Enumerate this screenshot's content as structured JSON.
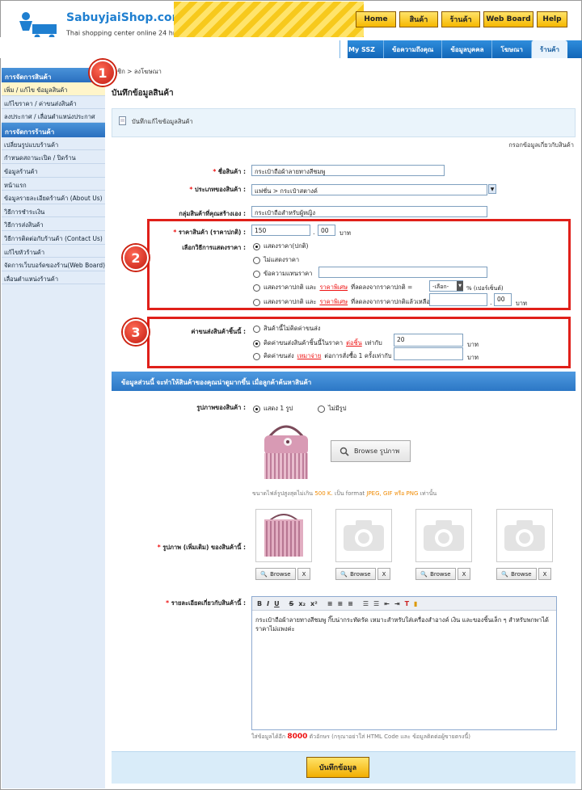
{
  "brand": {
    "name_a": "Sabuyjai",
    "name_b": "Shop.com",
    "reg": "®",
    "tagline": "Thai shopping center online 24 hr.",
    "tm": "TM"
  },
  "topnav": [
    "Home",
    "สินค้า",
    "ร้านค้า",
    "Web Board",
    "Help"
  ],
  "subnav": [
    {
      "label": "My SSZ",
      "active": false
    },
    {
      "label": "ข้อความถึงคุณ",
      "active": false
    },
    {
      "label": "ข้อมูลบุคคล",
      "active": false
    },
    {
      "label": "โฆษณา",
      "active": false
    },
    {
      "label": "ร้านค้า",
      "active": true
    }
  ],
  "sidebar": {
    "group1": "การจัดการสินค้า",
    "items1": [
      "เพิ่ม / แก้ไข ข้อมูลสินค้า",
      "แก้ไขราคา / ค่าขนส่งสินค้า",
      "ลงประกาศ / เลื่อนตำแหน่งประกาศ"
    ],
    "group2": "การจัดการร้านค้า",
    "items2": [
      "เปลี่ยนรูปแบบร้านค้า",
      "กำหนดสถานะเปิด / ปิดร้าน",
      "ข้อมูลร้านค้า",
      "หน้าแรก",
      "ข้อมูลรายละเอียดร้านค้า (About Us)",
      "วิธีการชำระเงิน",
      "วิธีการส่งสินค้า",
      "วิธีการติดต่อกับร้านค้า (Contact Us)",
      "แก้ไขหัวร้านค้า",
      "จัดการเว็บบอร์ดของร้าน(Web Board)",
      "เลื่อนตำแหน่งร้านค้า"
    ]
  },
  "breadcrumb": "...ชิก > ลงโฆษณา",
  "page_title": "บันทึกข้อมูลสินค้า",
  "panel_title": "บันทึกแก้ไขข้อมูลสินค้า",
  "fill_note": "กรอกข้อมูลเกี่ยวกับสินค้า",
  "form": {
    "name_label": "ชื่อสินค้า :",
    "name_value": "กระเป๋าถือผ้าลายทางสีชมพู",
    "type_label": "ประเภทของสินค้า :",
    "type_value": "แฟชั่น > กระเป๋าสตางค์",
    "group_label": "กลุ่มสินค้าที่คุณสร้างเอง :",
    "group_value": "กระเป๋าถือสำหรับผู้หญิง",
    "price_label": "ราคาสินค้า (ราคาปกติ) :",
    "price_int": "150",
    "price_dec": "00",
    "baht": "บาท",
    "display_label": "เลือกวิธีการแสดงราคา :",
    "display_opts": [
      "แสดงราคา(ปกติ)",
      "ไม่แสดงราคา",
      "ข้อความแทนราคา"
    ],
    "disc1_a": "แสดงราคาปกติ และ",
    "disc1_link": "ราคาพิเศษ",
    "disc1_b": "ที่ลดลงจากราคาปกติ =",
    "disc1_select": "-เลือก-",
    "disc1_c": "% (เปอร์เซ็นต์)",
    "disc2_a": "แสดงราคาปกติ และ",
    "disc2_link": "ราคาพิเศษ",
    "disc2_b": "ที่ลดลงจากราคาปกติแล้วเหลือ",
    "disc2_dec": "00",
    "ship_label": "ค่าขนส่งสินค้าชิ้นนี้ :",
    "ship_opt1": "สินค้านี้ไม่คิดค่าขนส่ง",
    "ship_opt2_a": "คิดค่าขนส่งสินค้าชิ้นนี้ในราคา",
    "ship_opt2_link": "ต่อชิ้น",
    "ship_opt2_b": "เท่ากับ",
    "ship_value": "20",
    "ship_opt3_a": "คิดค่าขนส่ง",
    "ship_opt3_link": "เหมาจ่าย",
    "ship_opt3_b": "ต่อการสั่งซื้อ 1 ครั้งเท่ากับ"
  },
  "section_banner": "ข้อมูลส่วนนี้ จะทำให้สินค้าของคุณน่าดูมากขึ้น เมื่อลูกค้าค้นหาสินค้า",
  "image": {
    "label": "รูปภาพของสินค้า :",
    "opt_show": "แสดง 1 รูป",
    "opt_none": "ไม่มีรูป",
    "browse": "Browse รูปภาพ",
    "note_a": "ขนาดไฟล์รูปสูงสุดไม่เกิน",
    "note_size": "500 K.",
    "note_b": "เป็น format",
    "note_formats": "JPEG, GIF หรือ PNG",
    "note_c": "เท่านั้น",
    "extra_label": "รูปภาพ (เพิ่มเติม) ของสินค้านี้ :",
    "thumb_browse": "Browse",
    "thumb_x": "X"
  },
  "details": {
    "label": "รายละเอียดเกี่ยวกับสินค้านี้ :",
    "toolbar": [
      "B",
      "I",
      "U",
      "S",
      "x₂",
      "x²"
    ],
    "text": "กระเป๋าถือผ้าลายทางสีชมพู กิ๊บน่ากระทัดรัด เหมาะสำหรับใส่เครื่องสำอางค์ เงิน และของชิ้นเล็ก ๆ สำหรับพกพาได้ ราคาไม่แพงค่ะ",
    "limit_a": "ใส่ข้อมูลได้อีก",
    "limit_n": "8000",
    "limit_b": "ตัวอักษร (กรุณาอย่าใส่ HTML Code และ ข้อมูลติดต่อผู้ขายตรงนี้)"
  },
  "save_button": "บันทึกข้อมูล",
  "badges": [
    "1",
    "2",
    "3"
  ],
  "colors": {
    "accent_blue": "#1f6fc0",
    "highlight_red": "#e0201a",
    "button_yellow": "#f6b800"
  }
}
